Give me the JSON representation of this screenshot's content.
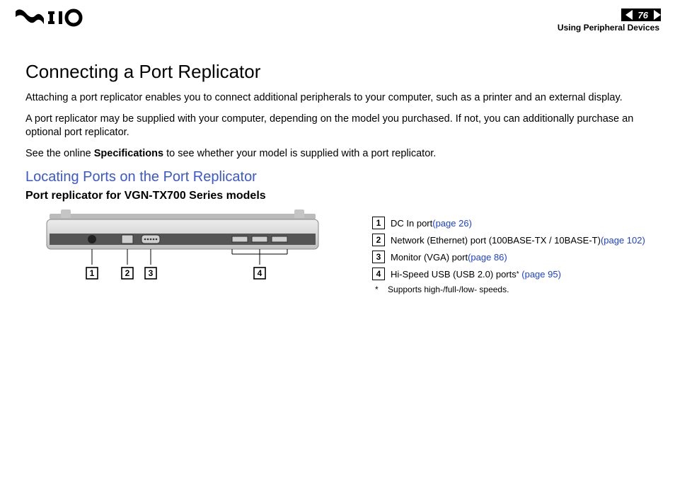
{
  "header": {
    "page_number": "76",
    "breadcrumb": "Using Peripheral Devices"
  },
  "title": "Connecting a Port Replicator",
  "paragraphs": {
    "p1": "Attaching a port replicator enables you to connect additional peripherals to your computer, such as a printer and an external display.",
    "p2": "A port replicator may be supplied with your computer, depending on the model you purchased. If not, you can additionally purchase an optional port replicator.",
    "p3_prefix": "See the online ",
    "p3_bold": "Specifications",
    "p3_suffix": " to see whether your model is supplied with a port replicator."
  },
  "subtitle": "Locating Ports on the Port Replicator",
  "model_heading": "Port replicator for VGN-TX700 Series models",
  "legend": {
    "items": [
      {
        "num": "1",
        "text": "DC In port ",
        "link": "(page 26)"
      },
      {
        "num": "2",
        "text": "Network (Ethernet) port (100BASE-TX / 10BASE-T) ",
        "link": "(page 102)"
      },
      {
        "num": "3",
        "text": "Monitor (VGA) port ",
        "link": "(page 86)"
      },
      {
        "num": "4",
        "text": "Hi-Speed USB (USB 2.0) ports",
        "sup": "*",
        "link": "(page 95)"
      }
    ],
    "footnote_mark": "*",
    "footnote_text": "Supports high-/full-/low- speeds."
  }
}
